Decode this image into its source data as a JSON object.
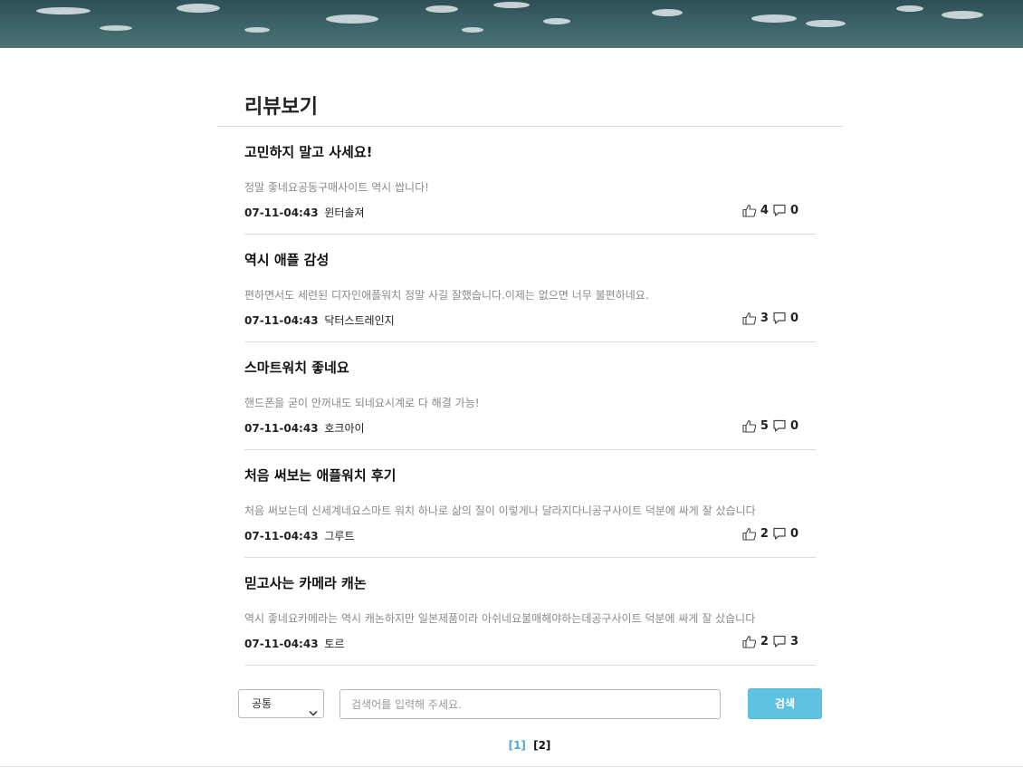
{
  "header": {
    "banner_alt": ""
  },
  "page": {
    "title": "리뷰보기"
  },
  "reviews": [
    {
      "title": "고민하지 말고 사세요!",
      "body": "정말 좋네요공동구매사이트 역시 쌉니다!",
      "date": "07-11-04:43",
      "author": "윈터솔져",
      "likes": "4",
      "comments": "0"
    },
    {
      "title": "역시 애플 감성",
      "body": "편하면서도 세련된 디자인애플워치 정말 사길 잘했습니다.이제는 없으면 너무 불편하네요.",
      "date": "07-11-04:43",
      "author": "닥터스트레인지",
      "likes": "3",
      "comments": "0"
    },
    {
      "title": "스마트워치 좋네요",
      "body": "핸드폰을 굳이 안꺼내도 되네요시계로 다 해결 가능!",
      "date": "07-11-04:43",
      "author": "호크아이",
      "likes": "5",
      "comments": "0"
    },
    {
      "title": "처음 써보는 애플워치 후기",
      "body": "처음 써보는데 신세계네요스마트 워치 하나로 삶의 질이 이렇게나 달라지다니공구사이트 덕분에 싸게 잘 샀습니다",
      "date": "07-11-04:43",
      "author": "그루트",
      "likes": "2",
      "comments": "0"
    },
    {
      "title": "믿고사는 카메라 캐논",
      "body": "역시 좋네요카메라는 역시 캐논하지만 일본제품이라 아쉬네요불매해야하는데공구사이트 덕분에 싸게 잘 샀습니다",
      "date": "07-11-04:43",
      "author": "토르",
      "likes": "2",
      "comments": "3"
    }
  ],
  "search": {
    "select_value": "공통",
    "placeholder": "검색어를 입력해 주세요.",
    "button_label": "검색"
  },
  "pagination": {
    "pages": [
      "[1]",
      "[2]"
    ],
    "current": "[1]"
  },
  "colors": {
    "accent": "#5fc2e0",
    "page_active": "#4aa8d6",
    "banner": "#3d6469"
  },
  "icons": {
    "like": "thumbs-up-icon",
    "comment": "comment-icon",
    "dropdown": "chevron-down-icon"
  }
}
